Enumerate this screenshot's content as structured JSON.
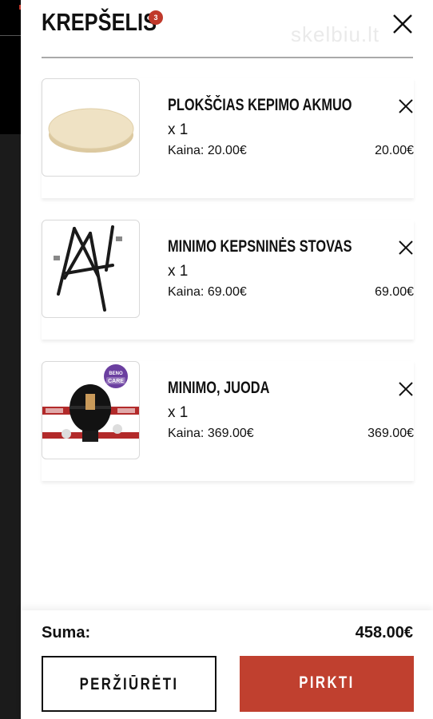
{
  "header": {
    "title": "KREPŠELIS",
    "cart_count": "3",
    "watermark": "skelbiu.lt"
  },
  "cart": {
    "items": [
      {
        "name": "PLOKŠČIAS KEPIMO AKMUO",
        "qty": "x 1",
        "price_label": "Kaina: 20.00€",
        "total": "20.00€",
        "image": "pizza-stone"
      },
      {
        "name": "MINIMO KEPSNINĖS STOVAS",
        "qty": "x 1",
        "price_label": "Kaina: 69.00€",
        "total": "69.00€",
        "image": "grill-stand"
      },
      {
        "name": "MINIMO, JUODA",
        "qty": "x 1",
        "price_label": "Kaina: 369.00€",
        "total": "369.00€",
        "image": "kamado-grill",
        "badge_line1": "BENO",
        "badge_line2": "CARE"
      }
    ]
  },
  "footer": {
    "sum_label": "Suma:",
    "sum_value": "458.00€",
    "view_label": "PERŽIŪRĖTI",
    "buy_label": "PIRKTI"
  },
  "colors": {
    "accent": "#c0402f",
    "badge": "#c0392b",
    "text": "#111111"
  }
}
